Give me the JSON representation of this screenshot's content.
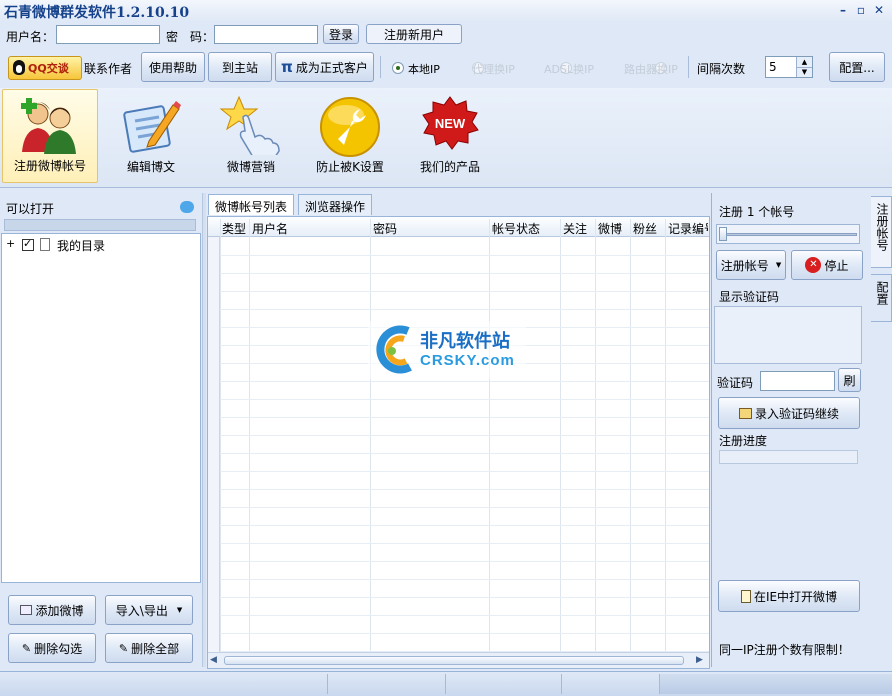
{
  "app": {
    "title": "石青微博群发软件1.2.10.10",
    "window_controls": {
      "minimize": "–",
      "restore": "▫",
      "close": "✕"
    }
  },
  "login": {
    "username_label": "用户名：",
    "username_value": "",
    "password_label": "密　码：",
    "password_value": "",
    "login_button": "登录",
    "register_button": "注册新用户"
  },
  "toolbar": {
    "qq_badge": "QQ交谈",
    "contact_author": "联系作者",
    "help": "使用帮助",
    "homepage": "到主站",
    "become_customer": "成为正式客户",
    "pi_symbol": "π",
    "ip_modes": [
      {
        "label": "本地IP",
        "selected": true,
        "enabled": true
      },
      {
        "label": "代理换IP",
        "selected": false,
        "enabled": false
      },
      {
        "label": "ADSL换IP",
        "selected": false,
        "enabled": false
      },
      {
        "label": "路由器换IP",
        "selected": false,
        "enabled": false
      }
    ],
    "interval_label": "间隔次数",
    "interval_value": "5",
    "config_button": "配置..."
  },
  "nav": {
    "items": [
      {
        "label": "注册微博帐号",
        "icon": "users-add-icon",
        "active": true
      },
      {
        "label": "编辑博文",
        "icon": "edit-document-icon",
        "active": false
      },
      {
        "label": "微博营销",
        "icon": "star-hand-icon",
        "active": false
      },
      {
        "label": "防止被K设置",
        "icon": "wrench-icon",
        "active": false
      },
      {
        "label": "我们的产品",
        "icon": "new-badge-icon",
        "active": false
      }
    ],
    "new_badge_text": "NEW"
  },
  "left": {
    "header": "可以打开",
    "tree": [
      {
        "label": "我的目录",
        "checked": true,
        "expand": "+"
      }
    ],
    "buttons": {
      "add": "添加微博",
      "import_export": "导入\\导出",
      "delete_checked": "删除勾选",
      "delete_all": "删除全部"
    }
  },
  "tabs": {
    "accounts": "微博帐号列表",
    "browser": "浏览器操作"
  },
  "grid": {
    "columns": [
      "类型",
      "用户名",
      "密码",
      "帐号状态",
      "关注",
      "微博",
      "粉丝",
      "记录编号"
    ],
    "rows": []
  },
  "watermark": {
    "name": "非凡软件站",
    "domain": "CRSKY.com"
  },
  "right": {
    "register_count": "注册 1 个帐号",
    "register_button": "注册帐号",
    "stop_button": "停止",
    "show_captcha": "显示验证码",
    "captcha_label": "验证码",
    "captcha_value": "",
    "refresh_button": "刷",
    "enter_captcha_button": "录入验证码继续",
    "progress_label": "注册进度",
    "progress": 0,
    "open_ie_button": "在IE中打开微博",
    "note": "同一IP注册个数有限制！"
  },
  "vertical_tabs": [
    "注册帐号",
    "配置"
  ]
}
